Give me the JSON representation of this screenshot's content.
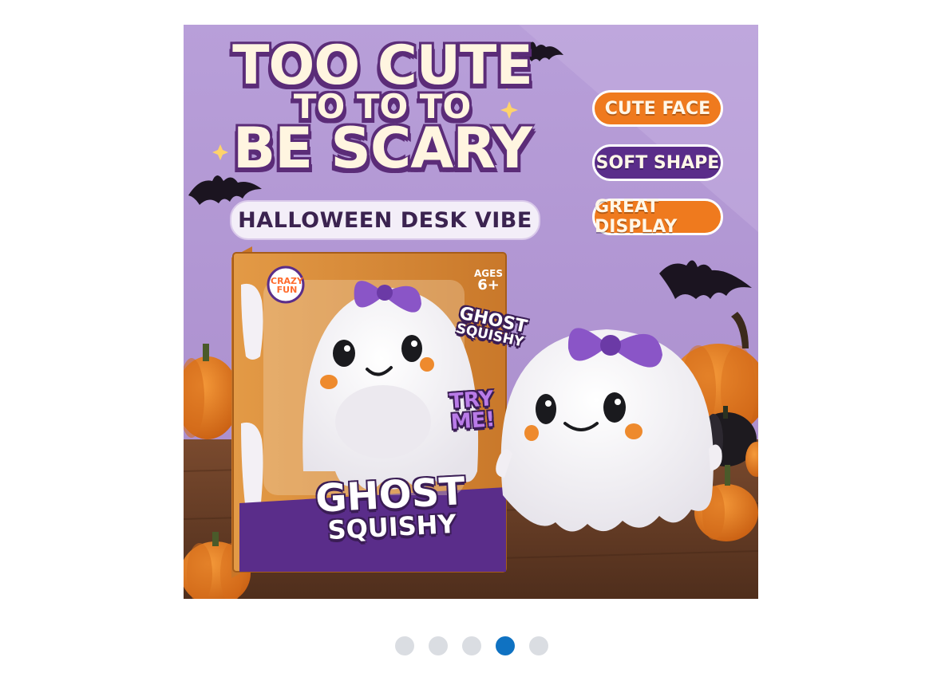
{
  "image": {
    "headline_line1": "TOO CUTE",
    "headline_line2": "TO TO TO",
    "headline_line3": "BE SCARY",
    "subtitle": "HALLOWEEN DESK VIBE",
    "features": [
      {
        "label": "CUTE FACE",
        "color": "#ef7a1e"
      },
      {
        "label": "SOFT SHAPE",
        "color": "#5a2d8a"
      },
      {
        "label": "GREAT DISPLAY",
        "color": "#ef7a1e"
      }
    ],
    "box": {
      "brand_line1": "CRAZY",
      "brand_line2": "FUN",
      "ages_line1": "AGES",
      "ages_line2": "6+",
      "side_text_line1": "GHOST",
      "side_text_line2": "SQUISHY",
      "try_me_line1": "TRY",
      "try_me_line2": "ME!",
      "product_line1": "GHOST",
      "product_line2": "SQUISHY"
    }
  },
  "carousel": {
    "total": 5,
    "active_index": 3,
    "active_color": "#0f72c2",
    "inactive_color": "#dadde2"
  }
}
